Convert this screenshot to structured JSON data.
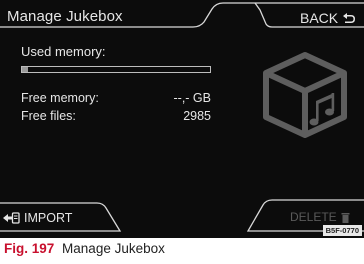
{
  "header": {
    "title": "Manage Jukebox",
    "back_label": "BACK",
    "back_icon": "back-arrow-icon"
  },
  "memory": {
    "used_label": "Used memory:",
    "used_fraction": 0.03,
    "free_memory_label": "Free memory:",
    "free_memory_value": "--,- GB",
    "free_files_label": "Free files:",
    "free_files_value": "2985"
  },
  "media_icon": "music-cube-icon",
  "footer": {
    "import_label": "IMPORT",
    "import_icon": "import-icon",
    "delete_label": "DELETE",
    "delete_icon": "trash-icon",
    "code": "B5F-0770"
  },
  "caption": {
    "fig_label": "Fig. 197",
    "text": "Manage Jukebox"
  },
  "colors": {
    "screen_bg": "#0c0c0c",
    "text": "#e6e6e6",
    "disabled_text": "#5a5a5a",
    "caption_accent": "#c8102e"
  }
}
